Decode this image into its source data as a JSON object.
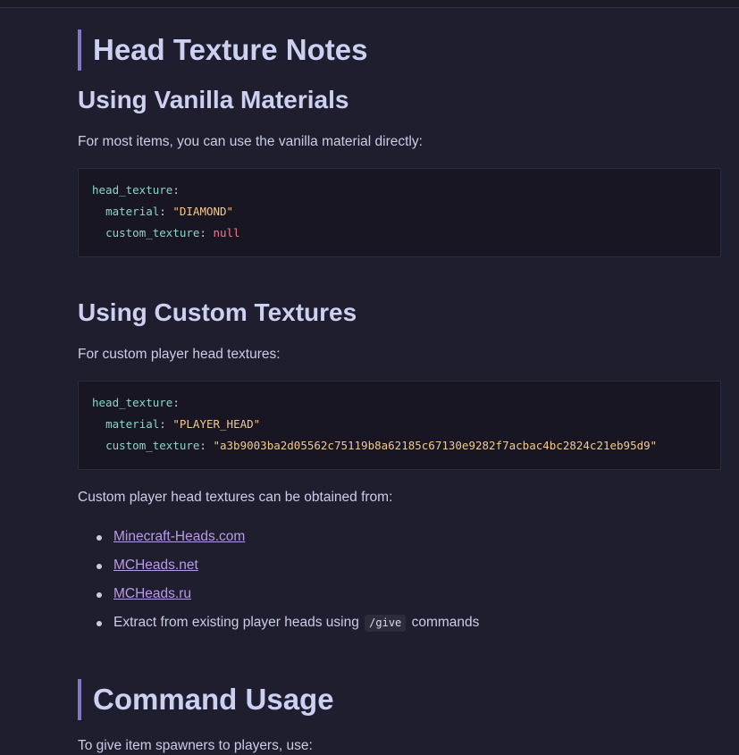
{
  "sections": {
    "head_texture_notes": {
      "title": "Head Texture Notes"
    },
    "vanilla": {
      "title": "Using Vanilla Materials",
      "intro": "For most items, you can use the vanilla material directly:",
      "code": {
        "root_key": "head_texture",
        "material_key": "material",
        "material_value": "\"DIAMOND\"",
        "custom_key": "custom_texture",
        "custom_value": "null"
      }
    },
    "custom": {
      "title": "Using Custom Textures",
      "intro": "For custom player head textures:",
      "code": {
        "root_key": "head_texture",
        "material_key": "material",
        "material_value": "\"PLAYER_HEAD\"",
        "custom_key": "custom_texture",
        "custom_value": "\"a3b9003ba2d05562c75119b8a62185c67130e9282f7acbac4bc2824c21eb95d9\""
      },
      "sources_intro": "Custom player head textures can be obtained from:",
      "sources": [
        "Minecraft-Heads.com",
        "MCHeads.net",
        "MCHeads.ru"
      ],
      "extract": {
        "before": "Extract from existing player heads using",
        "code": "/give",
        "after": "commands"
      }
    },
    "command_usage": {
      "title": "Command Usage",
      "intro": "To give item spawners to players, use:"
    }
  },
  "colors": {
    "background": "#1f1e2e",
    "code_background": "#171622",
    "heading_accent": "#8378c4",
    "link": "#b99ae6",
    "yaml_key": "#8fd3c9",
    "yaml_string": "#f2c98f",
    "yaml_null": "#f07b8c"
  }
}
